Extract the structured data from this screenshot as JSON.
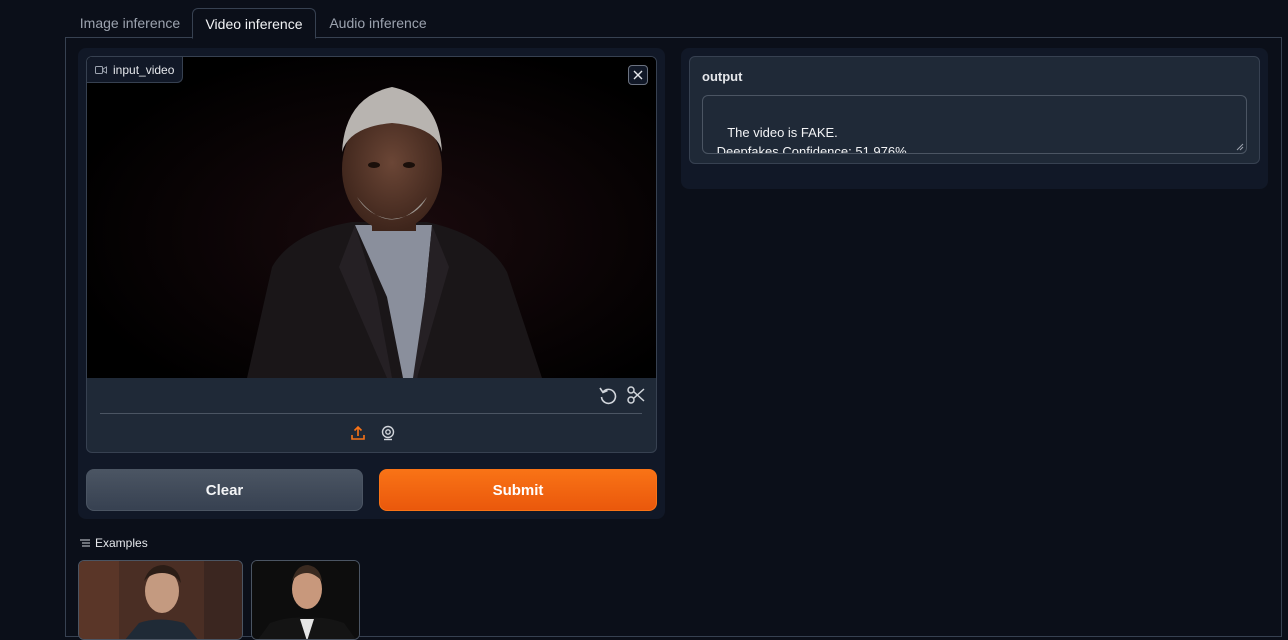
{
  "tabs": [
    {
      "label": "Image inference",
      "active": false
    },
    {
      "label": "Video inference",
      "active": true
    },
    {
      "label": "Audio inference",
      "active": false
    }
  ],
  "input_video": {
    "label": "input_video",
    "icons": {
      "label_icon": "video-camera-icon",
      "close": "close-icon",
      "undo": "undo-icon",
      "trim": "scissors-icon",
      "upload": "upload-icon",
      "webcam": "webcam-icon"
    }
  },
  "buttons": {
    "clear": "Clear",
    "submit": "Submit"
  },
  "output": {
    "label": "output",
    "value": "The video is FAKE.\n Deepfakes Confidence: 51.976%"
  },
  "examples": {
    "label": "Examples",
    "icon": "list-icon",
    "count": 2
  },
  "colors": {
    "accent": "#f97316",
    "background": "#0b0f19",
    "panel": "#111827",
    "block": "#1f2937"
  }
}
